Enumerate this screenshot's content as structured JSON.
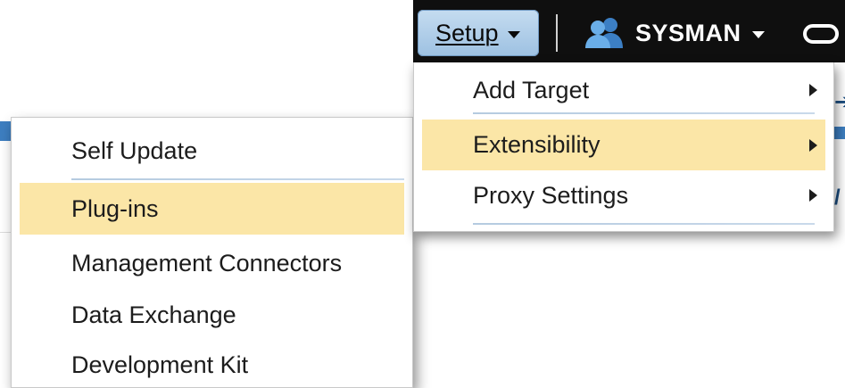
{
  "topbar": {
    "setup_label": "Setup",
    "user_label": "SYSMAN",
    "user_icon": "users-icon",
    "brand_icon": "oracle-ring-icon",
    "colors": {
      "bar": "#0f0f0f",
      "setup_button": "#b3d0eb"
    }
  },
  "setup_menu": {
    "items": [
      {
        "label": "Add Target",
        "has_submenu": true,
        "highlighted": false
      },
      {
        "label": "Extensibility",
        "has_submenu": true,
        "highlighted": true
      },
      {
        "label": "Proxy Settings",
        "has_submenu": true,
        "highlighted": false
      }
    ]
  },
  "extensibility_submenu": {
    "items": [
      {
        "label": "Self Update",
        "highlighted": false
      },
      {
        "label": "Plug-ins",
        "highlighted": true
      },
      {
        "label": "Management Connectors",
        "highlighted": false
      },
      {
        "label": "Data Exchange",
        "highlighted": false
      },
      {
        "label": "Development Kit",
        "highlighted": false
      }
    ]
  },
  "highlight_color": "#fbe6a7"
}
